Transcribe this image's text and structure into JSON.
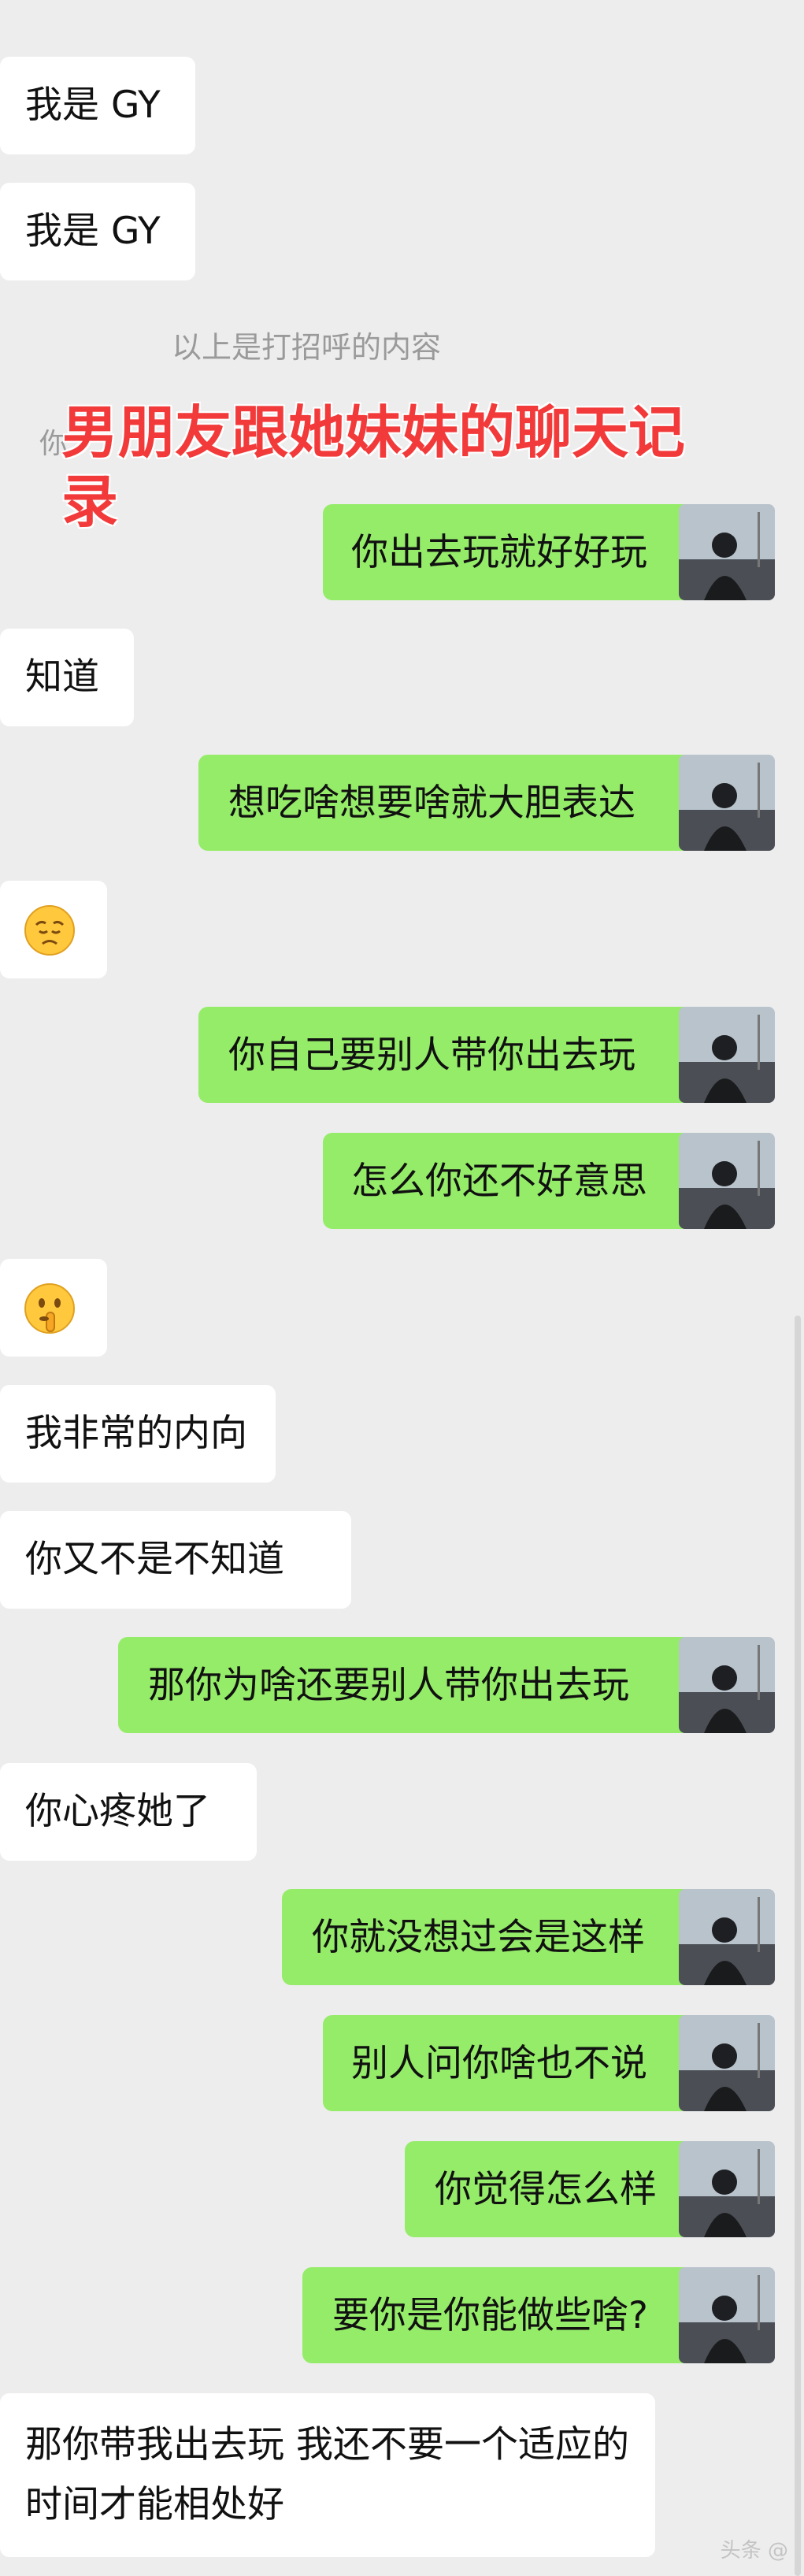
{
  "greeting_notice": "以上是打招呼的内容",
  "partial_hidden_text": "你",
  "overlay_title": "男朋友跟她妹妹的聊天记录",
  "messages": [
    {
      "side": "in",
      "text": "我是 GY"
    },
    {
      "side": "in",
      "text": "我是 GY"
    },
    {
      "side": "out",
      "text": "你出去玩就好好玩"
    },
    {
      "side": "in",
      "text": "知道"
    },
    {
      "side": "out",
      "text": "想吃啥想要啥就大胆表达"
    },
    {
      "side": "in",
      "emoji": "worried-face"
    },
    {
      "side": "out",
      "text": "你自己要别人带你出去玩"
    },
    {
      "side": "out",
      "text": "怎么你还不好意思"
    },
    {
      "side": "in",
      "emoji": "shushing-face"
    },
    {
      "side": "in",
      "text": "我非常的内向"
    },
    {
      "side": "in",
      "text": "你又不是不知道"
    },
    {
      "side": "out",
      "text": "那你为啥还要别人带你出去玩"
    },
    {
      "side": "in",
      "text": "你心疼她了"
    },
    {
      "side": "out",
      "text": "你就没想过会是这样"
    },
    {
      "side": "out",
      "text": "别人问你啥也不说"
    },
    {
      "side": "out",
      "text": "你觉得怎么样"
    },
    {
      "side": "out",
      "text": "要你是你能做些啥?"
    },
    {
      "side": "in",
      "text": "那你带我出去玩 我还不要一个适应的时间才能相处好"
    }
  ],
  "watermark": "头条 @",
  "colors": {
    "outgoing": "#95ec69",
    "incoming": "#ffffff",
    "background": "#ededed",
    "title": "#f23a3a"
  }
}
